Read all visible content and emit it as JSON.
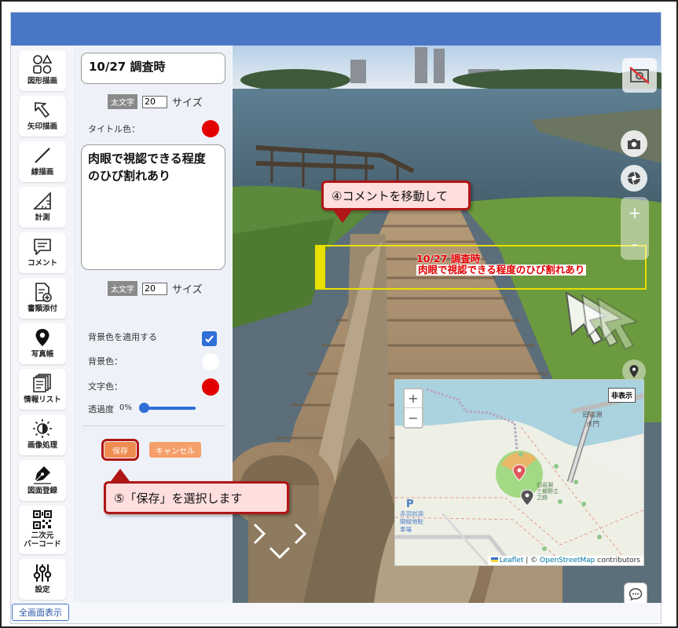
{
  "toolbar": {
    "items": [
      {
        "label": "図形描画",
        "icon": "shapes-icon"
      },
      {
        "label": "矢印描画",
        "icon": "arrow-icon"
      },
      {
        "label": "線描画",
        "icon": "line-icon"
      },
      {
        "label": "計測",
        "icon": "ruler-icon"
      },
      {
        "label": "コメント",
        "icon": "comment-icon"
      },
      {
        "label": "書類添付",
        "icon": "document-attach-icon"
      },
      {
        "label": "写真帳",
        "icon": "map-pin-icon"
      },
      {
        "label": "情報リスト",
        "icon": "list-icon"
      },
      {
        "label": "画像処理",
        "icon": "brightness-icon"
      },
      {
        "label": "図面登録",
        "icon": "pen-icon"
      },
      {
        "label": "二次元\nバーコード",
        "icon": "qr-code-icon"
      },
      {
        "label": "設定",
        "icon": "sliders-icon"
      }
    ],
    "fullscreen_label": "全画面表示"
  },
  "panel": {
    "title_value": "10/27 調査時",
    "bold_label": "太文字",
    "title_size": "20",
    "size_label": "サイズ",
    "title_color_label": "タイトル色：",
    "comment_value_line1": "肉眼で視認できる程度",
    "comment_value_line2": "のひび割れあり",
    "comment_size": "20",
    "apply_bg_label": "背景色を適用する",
    "bg_color_label": "背景色：",
    "text_color_label": "文字色：",
    "opacity_label": "透過度",
    "opacity_value": "0%",
    "save_label": "保存",
    "cancel_label": "キャンセル"
  },
  "viewer": {
    "overlay_title": "10/27 調査時",
    "overlay_comment": "肉眼で視認できる程度のひび割れあり",
    "zoom_in": "+",
    "zoom_out": "-"
  },
  "callouts": {
    "move_comment": "④コメントを移動して",
    "select_save": "⑤「保存」を選択します"
  },
  "map": {
    "zoom_in": "+",
    "zoom_out": "−",
    "hide_label": "非表示",
    "attr_leaflet": "Leaflet",
    "attr_sep": " | © ",
    "attr_osm": "OpenStreetMap",
    "attr_contrib": " contributors",
    "label_kyu_iwabuchi": "旧岩淵",
    "label_suimon": "水門",
    "label_parking_line1": "赤羽岩淵",
    "label_parking_line2": "閘緑地駐",
    "label_parking_line3": "車場",
    "label_shrine_line1": "旧岩淵",
    "label_shrine_line2": "三郷野立",
    "label_shrine_line3": "之跡"
  },
  "colors": {
    "header": "#4a76c6",
    "title_color": "#e30000",
    "text_color": "#e30000",
    "bg_color": "#ffffff",
    "accent": "#2f6fd6",
    "save": "#f08c50",
    "callout_border": "#b01616",
    "callout_fill": "#ffdede"
  }
}
